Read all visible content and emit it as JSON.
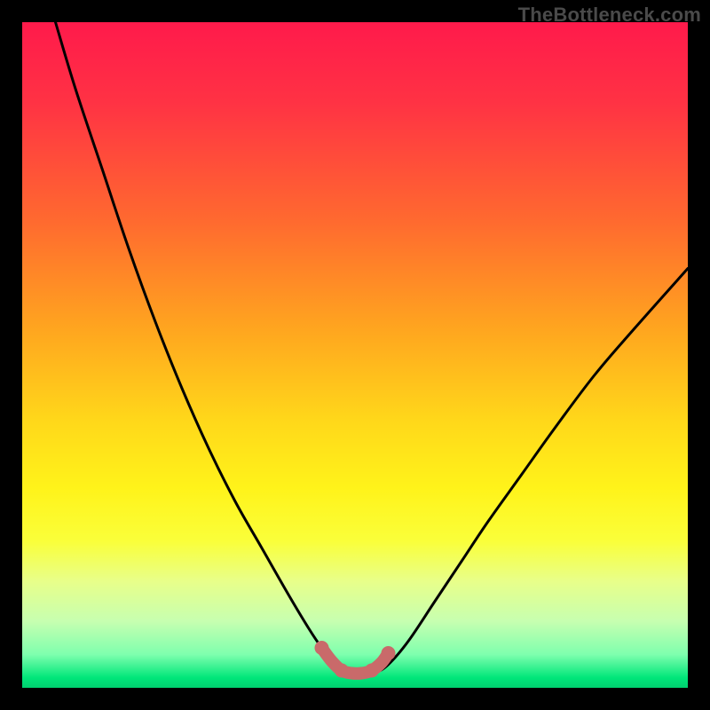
{
  "watermark": "TheBottleneck.com",
  "colors": {
    "page_bg": "#000000",
    "gradient_stops": [
      {
        "offset": 0.0,
        "color": "#ff1a4b"
      },
      {
        "offset": 0.12,
        "color": "#ff3244"
      },
      {
        "offset": 0.3,
        "color": "#ff6a2f"
      },
      {
        "offset": 0.46,
        "color": "#ffa51f"
      },
      {
        "offset": 0.6,
        "color": "#ffd81a"
      },
      {
        "offset": 0.7,
        "color": "#fff31a"
      },
      {
        "offset": 0.78,
        "color": "#faff3a"
      },
      {
        "offset": 0.84,
        "color": "#e8ff8a"
      },
      {
        "offset": 0.9,
        "color": "#c7ffb0"
      },
      {
        "offset": 0.95,
        "color": "#7effae"
      },
      {
        "offset": 0.985,
        "color": "#00e67a"
      },
      {
        "offset": 1.0,
        "color": "#00d070"
      }
    ],
    "curve_stroke": "#000000",
    "marker_stroke": "#c96a6a",
    "marker_fill": "#c96a6a"
  },
  "chart_data": {
    "type": "line",
    "title": "",
    "xlabel": "",
    "ylabel": "",
    "xlim": [
      0,
      100
    ],
    "ylim": [
      0,
      100
    ],
    "grid": false,
    "legend": false,
    "series": [
      {
        "name": "bottleneck-curve",
        "x": [
          5,
          8,
          12,
          16,
          20,
          24,
          28,
          32,
          36,
          40,
          43,
          45,
          47,
          49,
          51,
          53,
          55,
          58,
          62,
          66,
          70,
          75,
          80,
          86,
          92,
          100
        ],
        "y": [
          100,
          90,
          78,
          66,
          55,
          45,
          36,
          28,
          21,
          14,
          9,
          6,
          3.5,
          2.3,
          2.2,
          2.3,
          3.5,
          7,
          13,
          19,
          25,
          32,
          39,
          47,
          54,
          63
        ]
      },
      {
        "name": "highlight-segment",
        "x": [
          45,
          46.5,
          48,
          49.5,
          51,
          52.5,
          54,
          55
        ],
        "y": [
          6,
          4,
          2.6,
          2.2,
          2.2,
          2.6,
          3.8,
          5.2
        ]
      }
    ],
    "annotations": []
  }
}
